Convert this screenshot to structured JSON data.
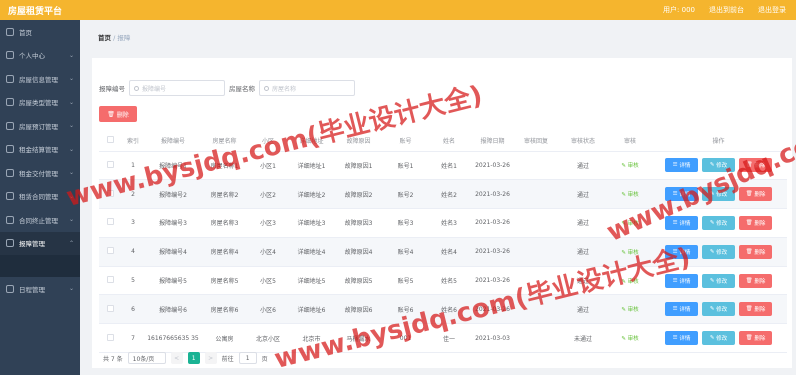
{
  "header": {
    "title": "房屋租赁平台",
    "user": "用户: 000",
    "home_link": "退出到前台",
    "logout_link": "退出登录"
  },
  "sidebar": {
    "items": [
      {
        "label": "首页"
      },
      {
        "label": "个人中心"
      },
      {
        "label": "房屋信息管理"
      },
      {
        "label": "房屋类型管理"
      },
      {
        "label": "房屋预订管理"
      },
      {
        "label": "租金结算管理"
      },
      {
        "label": "租金交付管理"
      },
      {
        "label": "租赁合同管理"
      },
      {
        "label": "合同终止管理"
      },
      {
        "label": "报障管理"
      },
      {
        "label": "日程管理"
      }
    ]
  },
  "breadcrumb": {
    "home": "首页",
    "separator": "/",
    "current": "报障"
  },
  "search": {
    "field1_label": "报障编号",
    "field1_placeholder": "报障编号",
    "field2_label": "房屋名称",
    "field2_placeholder": "房屋名称"
  },
  "toolbar": {
    "delete_label": "删除"
  },
  "table": {
    "headers": [
      "",
      "索引",
      "报障编号",
      "房屋名称",
      "小区",
      "详细地址",
      "故障原因",
      "账号",
      "姓名",
      "报障日期",
      "审核回复",
      "审核状态",
      "审核",
      "操作"
    ],
    "rows": [
      {
        "index": "1",
        "code": "报障编号1",
        "name": "房屋名称1",
        "community": "小区1",
        "address": "详细地址1",
        "reason": "故障原因1",
        "account": "账号1",
        "person": "姓名1",
        "date": "2021-03-26",
        "reply": "",
        "status": "通过",
        "audit": "审核"
      },
      {
        "index": "2",
        "code": "报障编号2",
        "name": "房屋名称2",
        "community": "小区2",
        "address": "详细地址2",
        "reason": "故障原因2",
        "account": "账号2",
        "person": "姓名2",
        "date": "2021-03-26",
        "reply": "",
        "status": "通过",
        "audit": "审核"
      },
      {
        "index": "3",
        "code": "报障编号3",
        "name": "房屋名称3",
        "community": "小区3",
        "address": "详细地址3",
        "reason": "故障原因3",
        "account": "账号3",
        "person": "姓名3",
        "date": "2021-03-26",
        "reply": "",
        "status": "通过",
        "audit": "审核"
      },
      {
        "index": "4",
        "code": "报障编号4",
        "name": "房屋名称4",
        "community": "小区4",
        "address": "详细地址4",
        "reason": "故障原因4",
        "account": "账号4",
        "person": "姓名4",
        "date": "2021-03-26",
        "reply": "",
        "status": "通过",
        "audit": "审核"
      },
      {
        "index": "5",
        "code": "报障编号5",
        "name": "房屋名称5",
        "community": "小区5",
        "address": "详细地址5",
        "reason": "故障原因5",
        "account": "账号5",
        "person": "姓名5",
        "date": "2021-03-26",
        "reply": "",
        "status": "通过",
        "audit": "审核"
      },
      {
        "index": "6",
        "code": "报障编号6",
        "name": "房屋名称6",
        "community": "小区6",
        "address": "详细地址6",
        "reason": "故障原因6",
        "account": "账号6",
        "person": "姓名6",
        "date": "2021-03-26",
        "reply": "",
        "status": "通过",
        "audit": "审核"
      },
      {
        "index": "7",
        "code": "16167665635 35",
        "name": "公寓房",
        "community": "北京小区",
        "address": "北京市",
        "reason": "马桶漏水",
        "account": "001",
        "person": "佳一",
        "date": "2021-03-03",
        "reply": "",
        "status": "未通过",
        "audit": "审核"
      }
    ],
    "btn_detail": "详情",
    "btn_edit": "修改",
    "btn_delete": "删除"
  },
  "pagination": {
    "total": "共 7 条",
    "page_size": "10条/页",
    "prev": "<",
    "current": "1",
    "next": ">",
    "goto_label": "前往",
    "goto_value": "1",
    "page_suffix": "页"
  },
  "watermark": {
    "text": "www.bysjdq.com(毕业设计大全)"
  },
  "colors": {
    "header": "#f5b52e",
    "sidebar": "#304156",
    "danger": "#f56c6c",
    "primary": "#409eff",
    "info": "#5bc0de",
    "success": "#67c23a",
    "pager_active": "#1ab394"
  }
}
